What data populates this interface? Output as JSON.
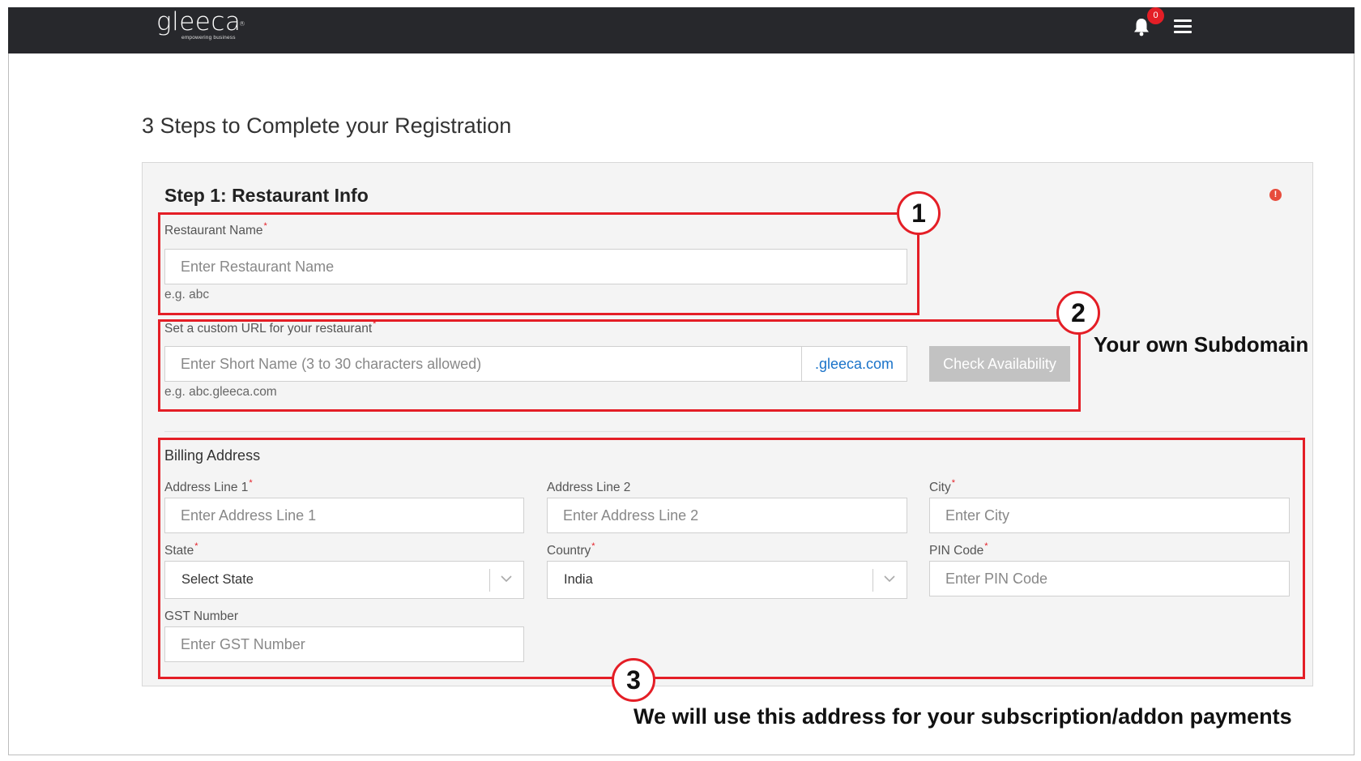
{
  "header": {
    "logo_text": "gleeca",
    "logo_mark": "®",
    "tagline": "empowering business",
    "notification_icon": "bell-icon",
    "notification_count": "0",
    "menu_icon": "hamburger-menu-icon"
  },
  "page": {
    "title": "3 Steps to Complete your Registration"
  },
  "step1": {
    "title": "Step 1: Restaurant Info",
    "info_icon": "!",
    "restaurant_name": {
      "label": "Restaurant Name",
      "required": "*",
      "placeholder": "Enter Restaurant Name",
      "hint": "e.g. abc"
    },
    "custom_url": {
      "label": "Set a custom URL for your restaurant",
      "required": "*",
      "placeholder": "Enter Short Name (3 to 30 characters allowed)",
      "suffix": ".gleeca.com",
      "button": "Check Availability",
      "hint": "e.g. abc.gleeca.com"
    }
  },
  "billing": {
    "title": "Billing Address",
    "address1": {
      "label": "Address Line 1",
      "required": "*",
      "placeholder": "Enter Address Line 1"
    },
    "address2": {
      "label": "Address Line 2",
      "placeholder": "Enter Address Line 2"
    },
    "city": {
      "label": "City",
      "required": "*",
      "placeholder": "Enter City"
    },
    "state": {
      "label": "State",
      "required": "*",
      "value": "Select State"
    },
    "country": {
      "label": "Country",
      "required": "*",
      "value": "India"
    },
    "pin": {
      "label": "PIN Code",
      "required": "*",
      "placeholder": "Enter PIN Code"
    },
    "gst": {
      "label": "GST Number",
      "placeholder": "Enter GST Number"
    }
  },
  "annotations": {
    "marker1": "1",
    "marker2": "2",
    "marker3": "3",
    "subdomain_note": "Your own Subdomain",
    "address_note": "We will use this address for your subscription/addon payments"
  },
  "colors": {
    "header_bg": "#27282c",
    "annotation_red": "#e41e26",
    "link_blue": "#1a73c9",
    "card_bg": "#f4f4f4"
  }
}
